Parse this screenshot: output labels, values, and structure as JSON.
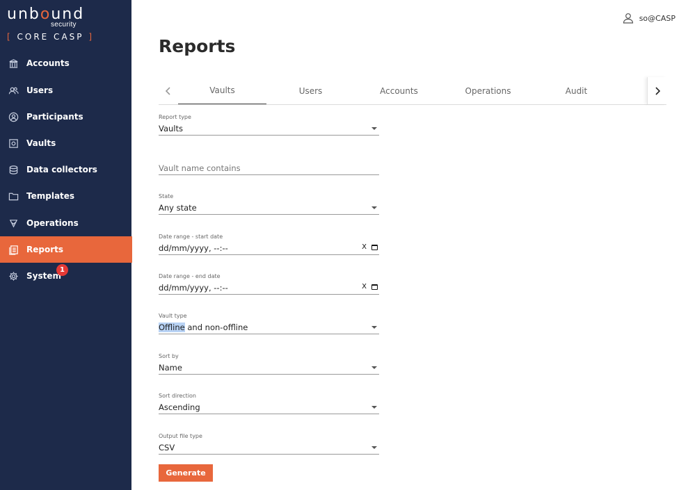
{
  "brand": {
    "name_pre": "unb",
    "name_o": "o",
    "name_post": "und",
    "sub": "security",
    "product_open": "[ ",
    "product": "CORE CASP",
    "product_close": " ]"
  },
  "sidebar": {
    "items": [
      {
        "label": "Accounts",
        "icon": "bank-icon"
      },
      {
        "label": "Users",
        "icon": "users-icon"
      },
      {
        "label": "Participants",
        "icon": "participant-icon"
      },
      {
        "label": "Vaults",
        "icon": "vault-icon"
      },
      {
        "label": "Data collectors",
        "icon": "database-icon"
      },
      {
        "label": "Templates",
        "icon": "folder-icon"
      },
      {
        "label": "Operations",
        "icon": "operations-icon"
      },
      {
        "label": "Reports",
        "icon": "reports-icon",
        "active": true
      },
      {
        "label": "System",
        "icon": "gear-icon",
        "badge": "1"
      }
    ]
  },
  "header": {
    "user": "so@CASP",
    "title": "Reports"
  },
  "tabs": [
    "Vaults",
    "Users",
    "Accounts",
    "Operations",
    "Audit"
  ],
  "active_tab": "Vaults",
  "form": {
    "report_type": {
      "label": "Report type",
      "value": "Vaults"
    },
    "vault_name": {
      "placeholder": "Vault name contains"
    },
    "state": {
      "label": "State",
      "value": "Any state"
    },
    "start_date": {
      "label": "Date range - start date",
      "value": "dd/mm/yyyy, --:--",
      "clear": "X"
    },
    "end_date": {
      "label": "Date range - end date",
      "value": "dd/mm/yyyy, --:--",
      "clear": "X"
    },
    "vault_type": {
      "label": "Vault type",
      "value_highlight": "Offline",
      "value_rest": " and non-offline"
    },
    "sort_by": {
      "label": "Sort by",
      "value": "Name"
    },
    "sort_direction": {
      "label": "Sort direction",
      "value": "Ascending"
    },
    "output_type": {
      "label": "Output file type",
      "value": "CSV"
    },
    "generate_label": "Generate"
  },
  "colors": {
    "sidebar_bg": "#1d2a4a",
    "accent": "#e8673c",
    "badge": "#e53935"
  }
}
